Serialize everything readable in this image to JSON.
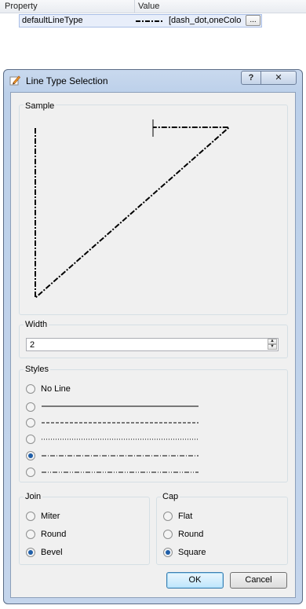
{
  "property_grid": {
    "col_property": "Property",
    "col_value": "Value",
    "row": {
      "name": "defaultLineType",
      "value": "[dash_dot,oneColo",
      "ellipsis": "..."
    }
  },
  "dialog": {
    "title": "Line Type Selection",
    "help_label": "?",
    "close_label": "✕",
    "sample": {
      "label": "Sample"
    },
    "width": {
      "label": "Width",
      "value": "2"
    },
    "styles": {
      "label": "Styles",
      "options": [
        {
          "id": "no-line",
          "label": "No Line",
          "selected": false
        },
        {
          "id": "solid",
          "label": "",
          "selected": false
        },
        {
          "id": "dash",
          "label": "",
          "selected": false
        },
        {
          "id": "dot",
          "label": "",
          "selected": false
        },
        {
          "id": "dash-dot",
          "label": "",
          "selected": true
        },
        {
          "id": "dash-dot-dot",
          "label": "",
          "selected": false
        }
      ]
    },
    "join": {
      "label": "Join",
      "options": [
        {
          "id": "miter",
          "label": "Miter",
          "selected": false
        },
        {
          "id": "round",
          "label": "Round",
          "selected": false
        },
        {
          "id": "bevel",
          "label": "Bevel",
          "selected": true
        }
      ]
    },
    "cap": {
      "label": "Cap",
      "options": [
        {
          "id": "flat",
          "label": "Flat",
          "selected": false
        },
        {
          "id": "round",
          "label": "Round",
          "selected": false
        },
        {
          "id": "square",
          "label": "Square",
          "selected": true
        }
      ]
    },
    "ok_label": "OK",
    "cancel_label": "Cancel"
  },
  "colors": {
    "accent": "#3c7fb1",
    "radio_dot": "#1f5ea8",
    "frame": "#bcd0ea"
  },
  "icons": {
    "title": "pencil-icon",
    "help": "help-icon",
    "close": "close-icon",
    "spin_up": "spin-up-icon",
    "spin_down": "spin-down-icon"
  }
}
